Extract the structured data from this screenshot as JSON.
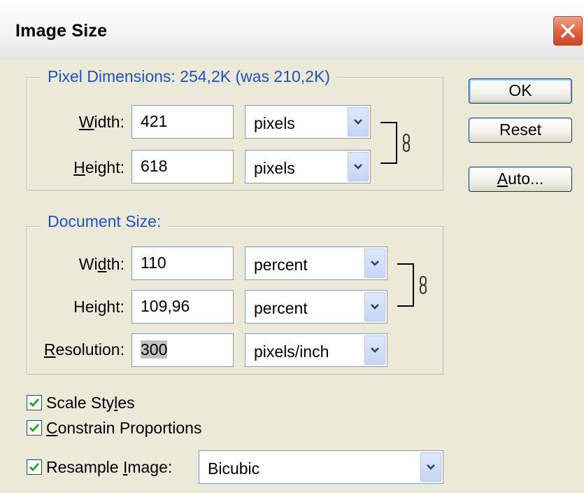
{
  "window": {
    "title": "Image Size"
  },
  "pixel_dimensions": {
    "legend": "Pixel Dimensions:  254,2K (was 210,2K)",
    "width": {
      "label_pre": "",
      "label_ul": "W",
      "label_post": "idth:",
      "value": "421",
      "unit": "pixels"
    },
    "height": {
      "label_pre": "",
      "label_ul": "H",
      "label_post": "eight:",
      "value": "618",
      "unit": "pixels"
    }
  },
  "document_size": {
    "legend": "Document Size:",
    "width": {
      "label_pre": "Wi",
      "label_ul": "d",
      "label_post": "th:",
      "value": "110",
      "unit": "percent"
    },
    "height": {
      "label_pre": "Hei",
      "label_ul": "g",
      "label_post": "ht:",
      "value": "109,96",
      "unit": "percent"
    },
    "resolution": {
      "label_pre": "",
      "label_ul": "R",
      "label_post": "esolution:",
      "value": "300",
      "unit": "pixels/inch"
    }
  },
  "buttons": {
    "ok": "OK",
    "reset": "Reset",
    "auto_ul": "A",
    "auto_post": "uto..."
  },
  "options": {
    "scale_styles": {
      "pre": "Scale Sty",
      "ul": "l",
      "post": "es",
      "checked": true
    },
    "constrain": {
      "pre": "",
      "ul": "C",
      "post": "onstrain Proportions",
      "checked": true
    },
    "resample": {
      "pre": "Resample ",
      "ul": "I",
      "post": "mage:",
      "checked": true,
      "method": "Bicubic"
    }
  },
  "icons": {
    "close": "close-icon",
    "chain": "chain-link-icon",
    "dropdown": "chevron-down-icon",
    "check": "checkmark-icon"
  },
  "colors": {
    "legend_text": "#2051c4",
    "close_button": "#e0603d",
    "dialog_bg": "#ece9d8"
  }
}
